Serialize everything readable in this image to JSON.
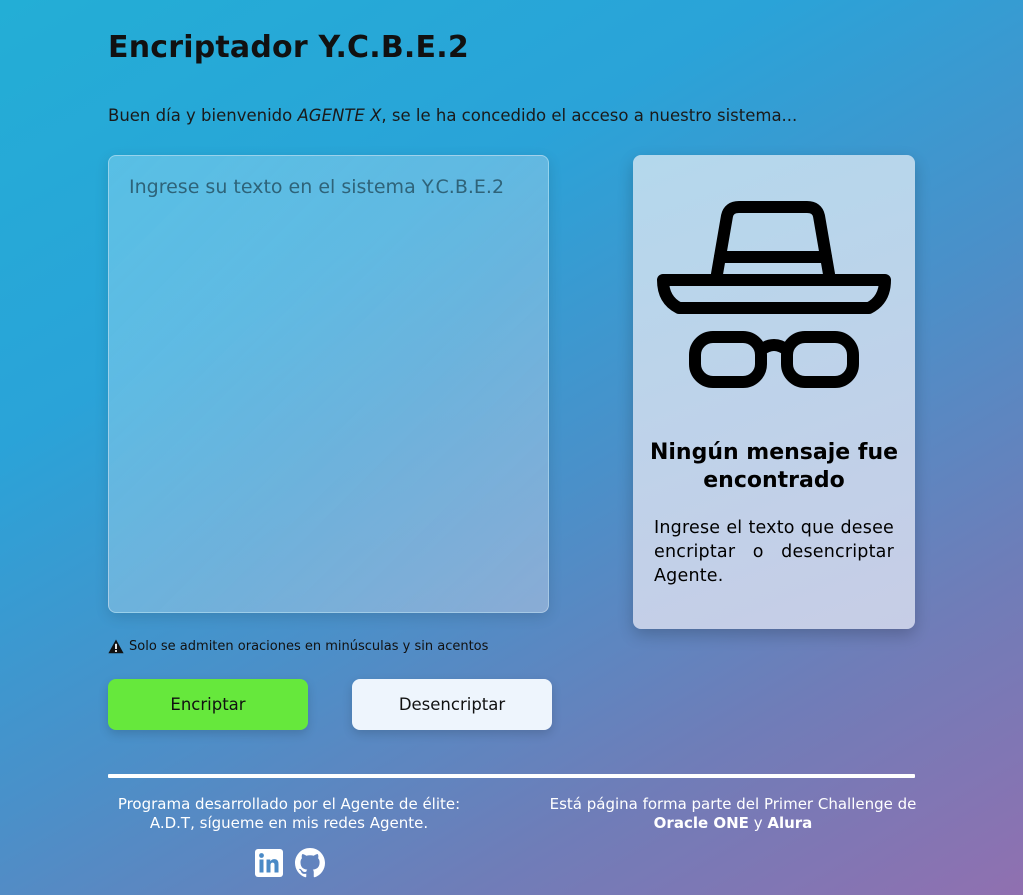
{
  "header": {
    "title": "Encriptador Y.C.B.E.2",
    "welcome_before": "Buen día y bienvenido ",
    "welcome_agent": "AGENTE X",
    "welcome_after": ", se le ha concedido el acceso a nuestro sistema..."
  },
  "input": {
    "placeholder": "Ingrese su texto en el sistema Y.C.B.E.2",
    "value": ""
  },
  "result": {
    "icon": "incognito-spy-icon",
    "title": "Ningún mensaje fue encontrado",
    "description": "Ingrese el texto que desee encriptar o desencriptar Agente."
  },
  "warning": {
    "icon": "warning-triangle-icon",
    "text": "Solo se admiten oraciones en minúsculas y sin acentos"
  },
  "buttons": {
    "encrypt": "Encriptar",
    "decrypt": "Desencriptar"
  },
  "footer": {
    "left_line1": "Programa desarrollado por el Agente de élite:",
    "left_line2": "A.D.T, sígueme en mis redes Agente.",
    "right_line1": "Está página forma parte del Primer Challenge de",
    "right_brand1": "Oracle ONE",
    "right_and": " y ",
    "right_brand2": "Alura",
    "social": [
      "linkedin-icon",
      "github-icon"
    ]
  },
  "colors": {
    "encrypt_button": "#66e83c",
    "decrypt_button": "#eef5fd",
    "gradient_start": "#23aed6",
    "gradient_end": "#9070b0"
  }
}
